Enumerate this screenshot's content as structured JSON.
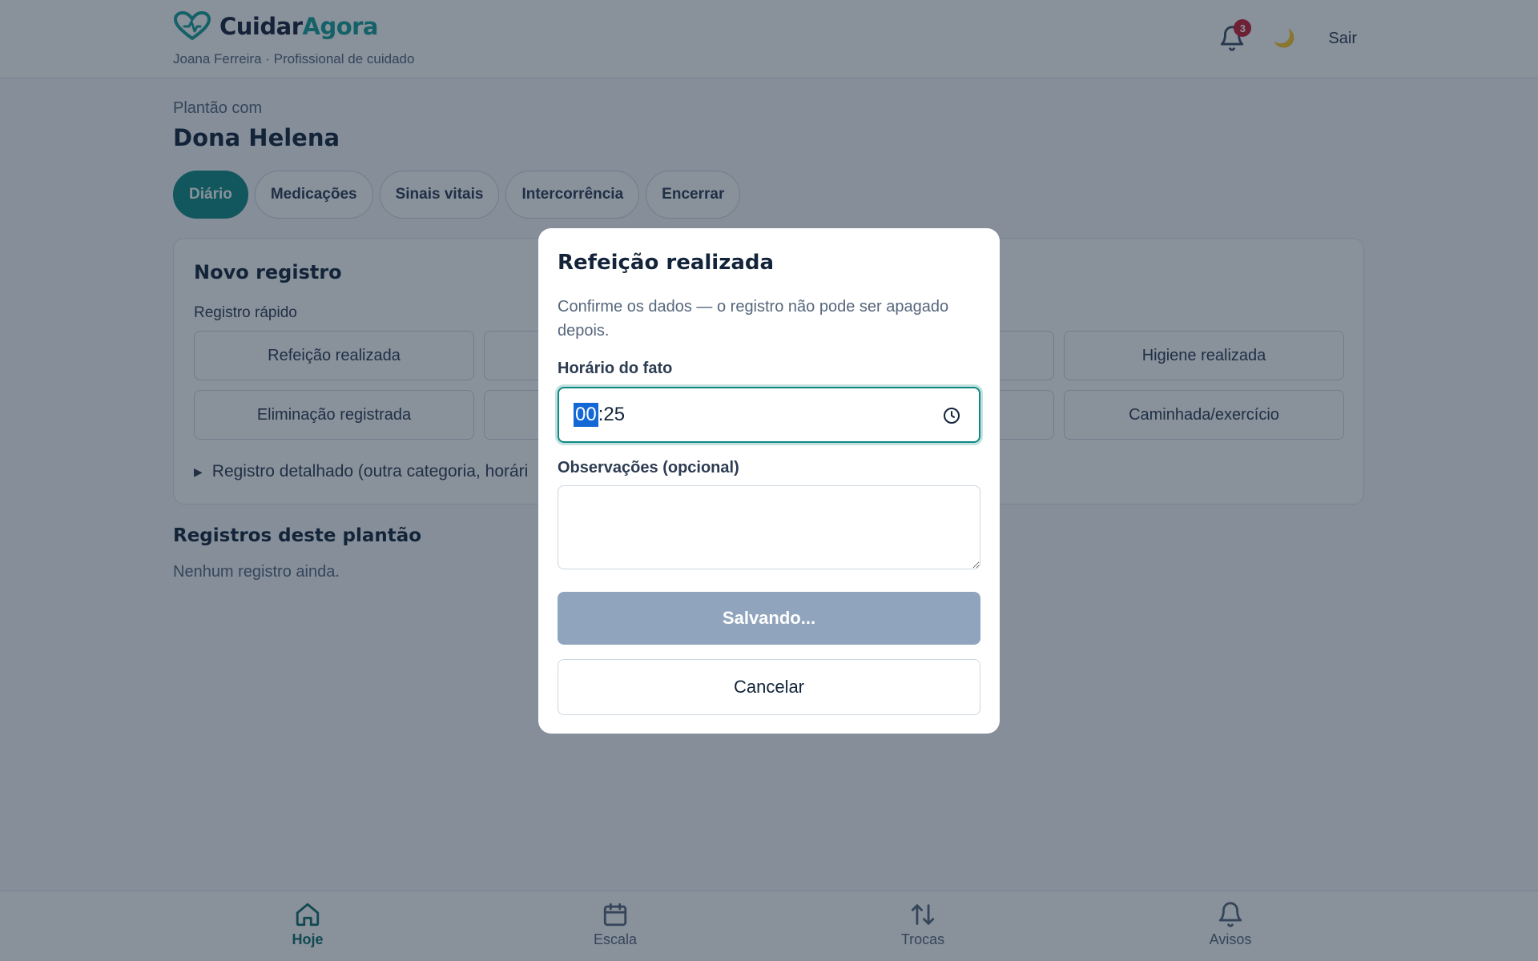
{
  "header": {
    "brand_first": "Cuidar",
    "brand_second": "Agora",
    "user_line": "Joana Ferreira · Profissional de cuidado",
    "notifications_count": "3",
    "theme_icon": "moon-icon",
    "logout_label": "Sair"
  },
  "shift": {
    "label": "Plantão com",
    "patient_name": "Dona Helena"
  },
  "tabs": [
    {
      "label": "Diário",
      "active": true
    },
    {
      "label": "Medicações",
      "active": false
    },
    {
      "label": "Sinais vitais",
      "active": false
    },
    {
      "label": "Intercorrência",
      "active": false
    },
    {
      "label": "Encerrar",
      "active": false
    }
  ],
  "new_record": {
    "title": "Novo registro",
    "quick_label": "Registro rápido",
    "quick_buttons": [
      "Refeição realizada",
      "",
      "",
      "Higiene realizada",
      "Eliminação registrada",
      "",
      "",
      "Caminhada/exercício"
    ],
    "detailed_label": "Registro detalhado (outra categoria, horári"
  },
  "records": {
    "title": "Registros deste plantão",
    "empty_text": "Nenhum registro ainda."
  },
  "bottom_nav": [
    {
      "label": "Hoje",
      "icon": "home-icon",
      "active": true
    },
    {
      "label": "Escala",
      "icon": "calendar-icon",
      "active": false
    },
    {
      "label": "Trocas",
      "icon": "swap-icon",
      "active": false
    },
    {
      "label": "Avisos",
      "icon": "bell-icon",
      "active": false
    }
  ],
  "modal": {
    "title": "Refeição realizada",
    "description": "Confirme os dados — o registro não pode ser apagado depois.",
    "time_label": "Horário do fato",
    "time_hours": "00",
    "time_minutes": "25",
    "notes_label": "Observações (opcional)",
    "notes_value": "",
    "save_label": "Salvando...",
    "cancel_label": "Cancelar"
  },
  "colors": {
    "brand_teal": "#149f98",
    "active_tab": "#0f8a82",
    "badge_red": "#c81d32",
    "save_disabled": "#90a4bd"
  }
}
